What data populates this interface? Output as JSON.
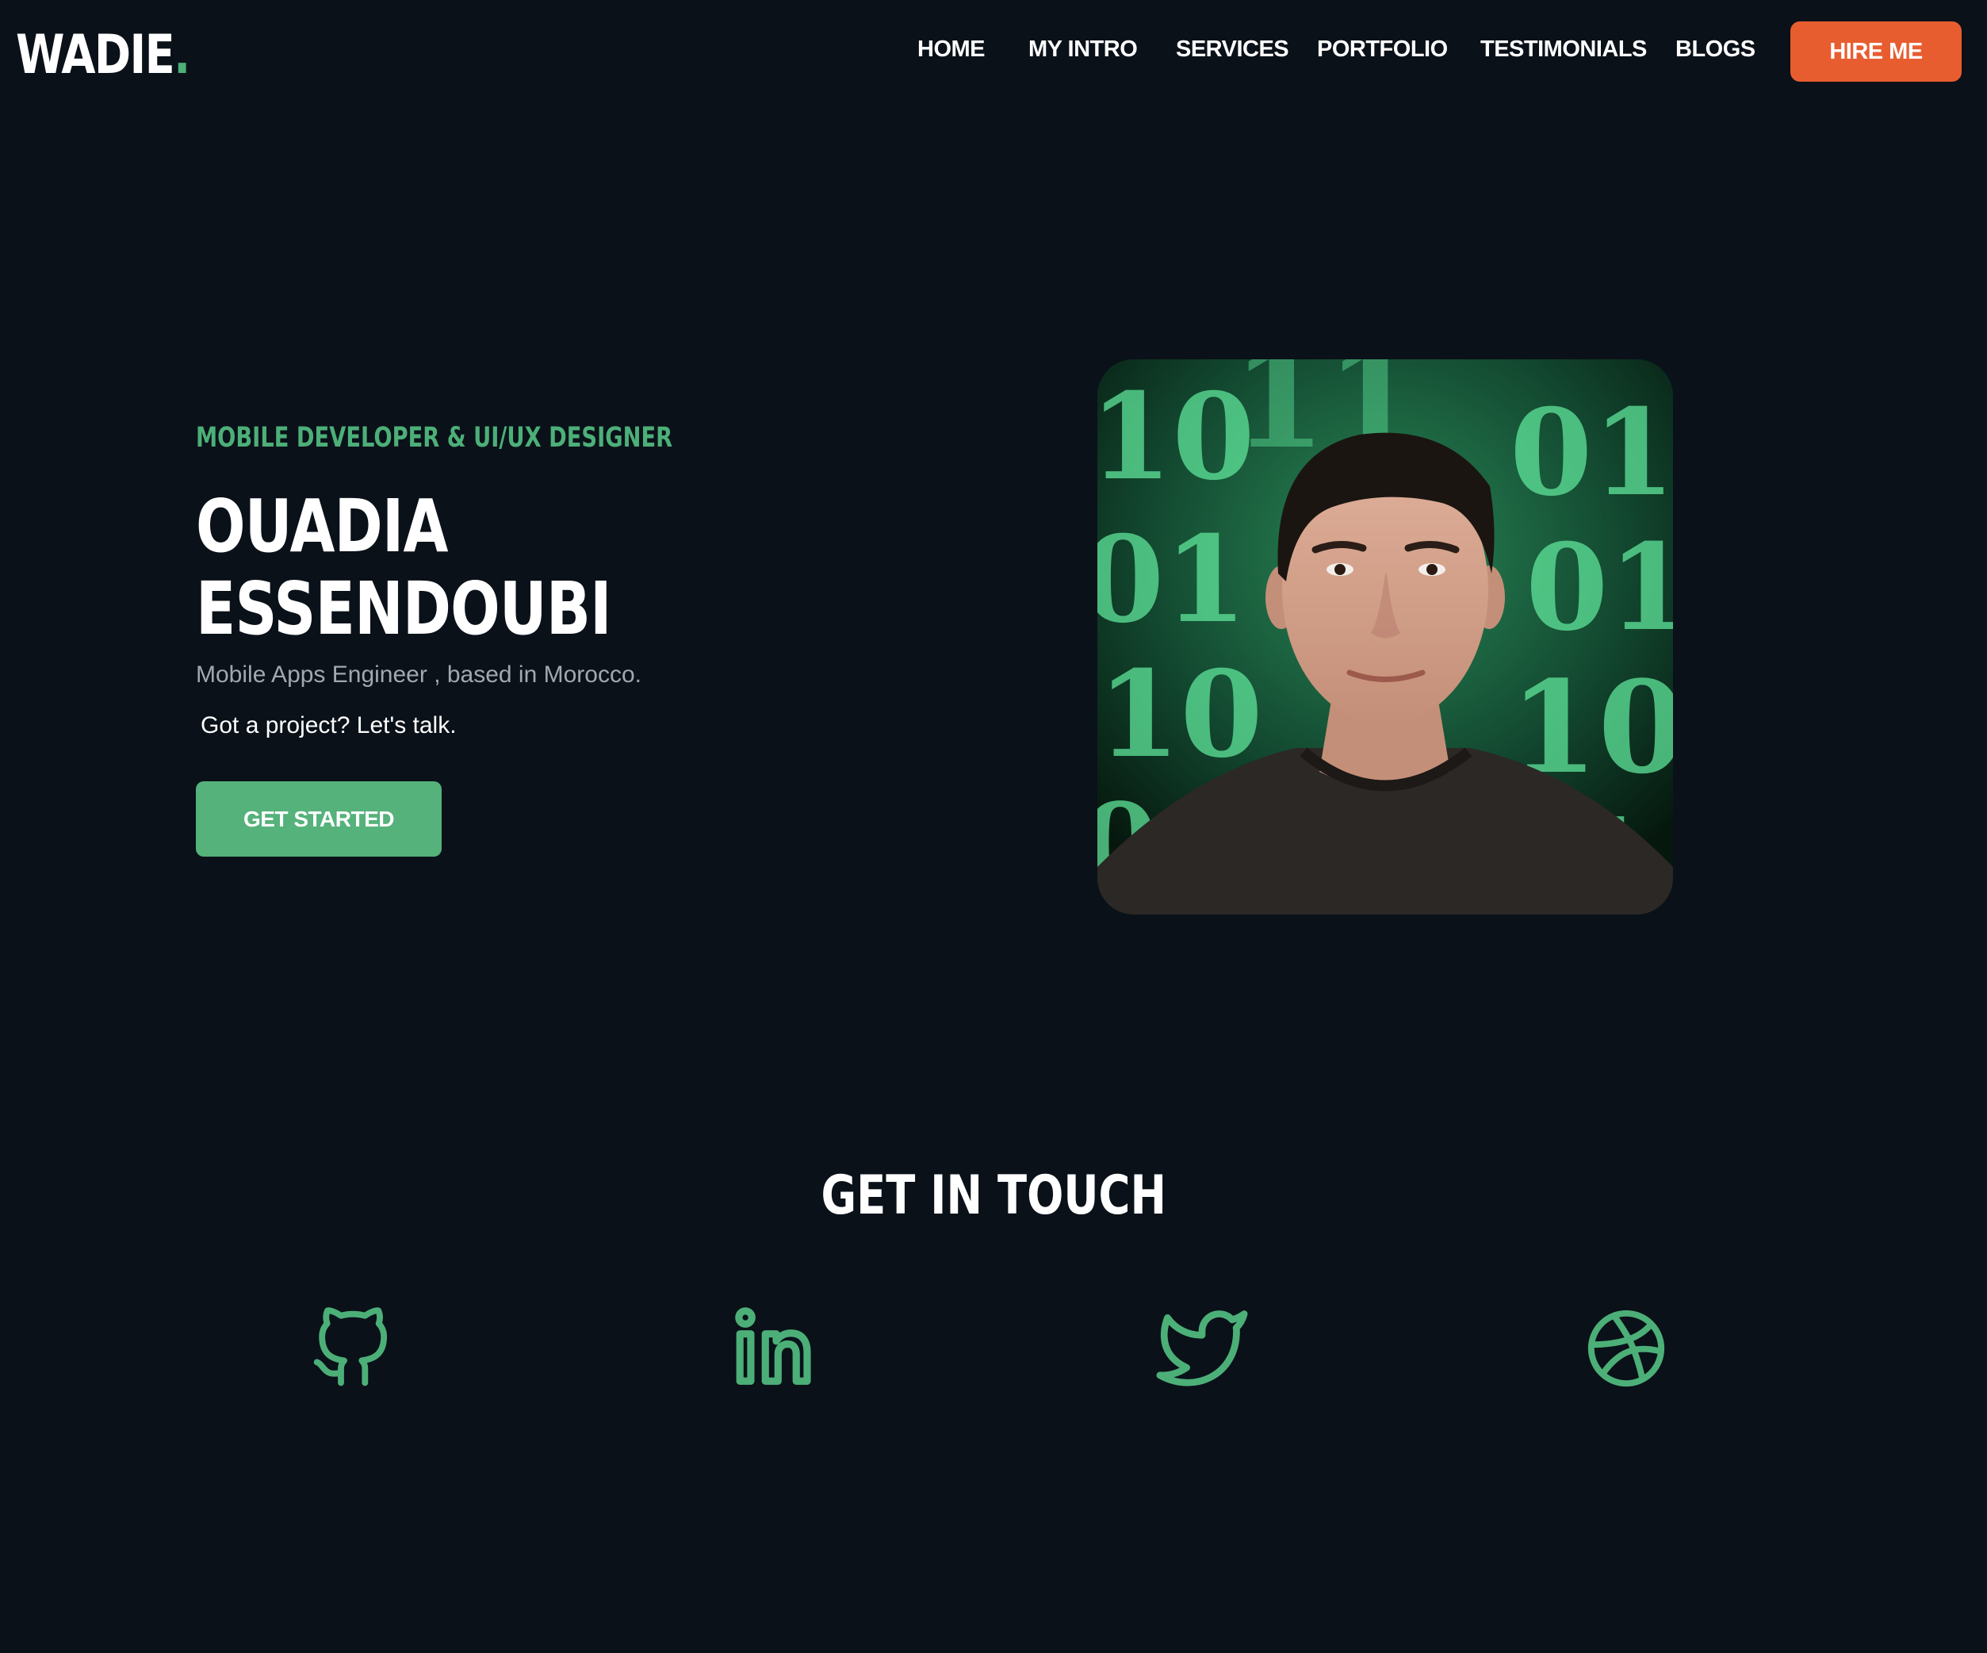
{
  "header": {
    "logo_text": "WADIE",
    "logo_dot": ".",
    "nav": [
      "HOME",
      "MY INTRO",
      "SERVICES",
      "PORTFOLIO",
      "TESTIMONIALS",
      "BLOGS"
    ],
    "hire_label": "HIRE ME"
  },
  "hero": {
    "eyebrow": "MOBILE DEVELOPER & UI/UX DESIGNER",
    "name_line1": "OUADIA",
    "name_line2": "ESSENDOUBI",
    "subtitle": "Mobile Apps Engineer , based in Morocco.",
    "cta_text": "Got a project? Let's talk.",
    "button_label": "GET STARTED",
    "photo_icon": "portrait-photo"
  },
  "contact": {
    "title": "GET IN TOUCH",
    "icons": [
      "github-icon",
      "linkedin-icon",
      "twitter-icon",
      "dribbble-icon"
    ]
  },
  "colors": {
    "background": "#0a1119",
    "accent_green": "#4caf78",
    "button_green": "#55b27b",
    "hire_orange": "#e85d30",
    "text_white": "#ffffff",
    "text_muted": "#a3a8ae"
  }
}
